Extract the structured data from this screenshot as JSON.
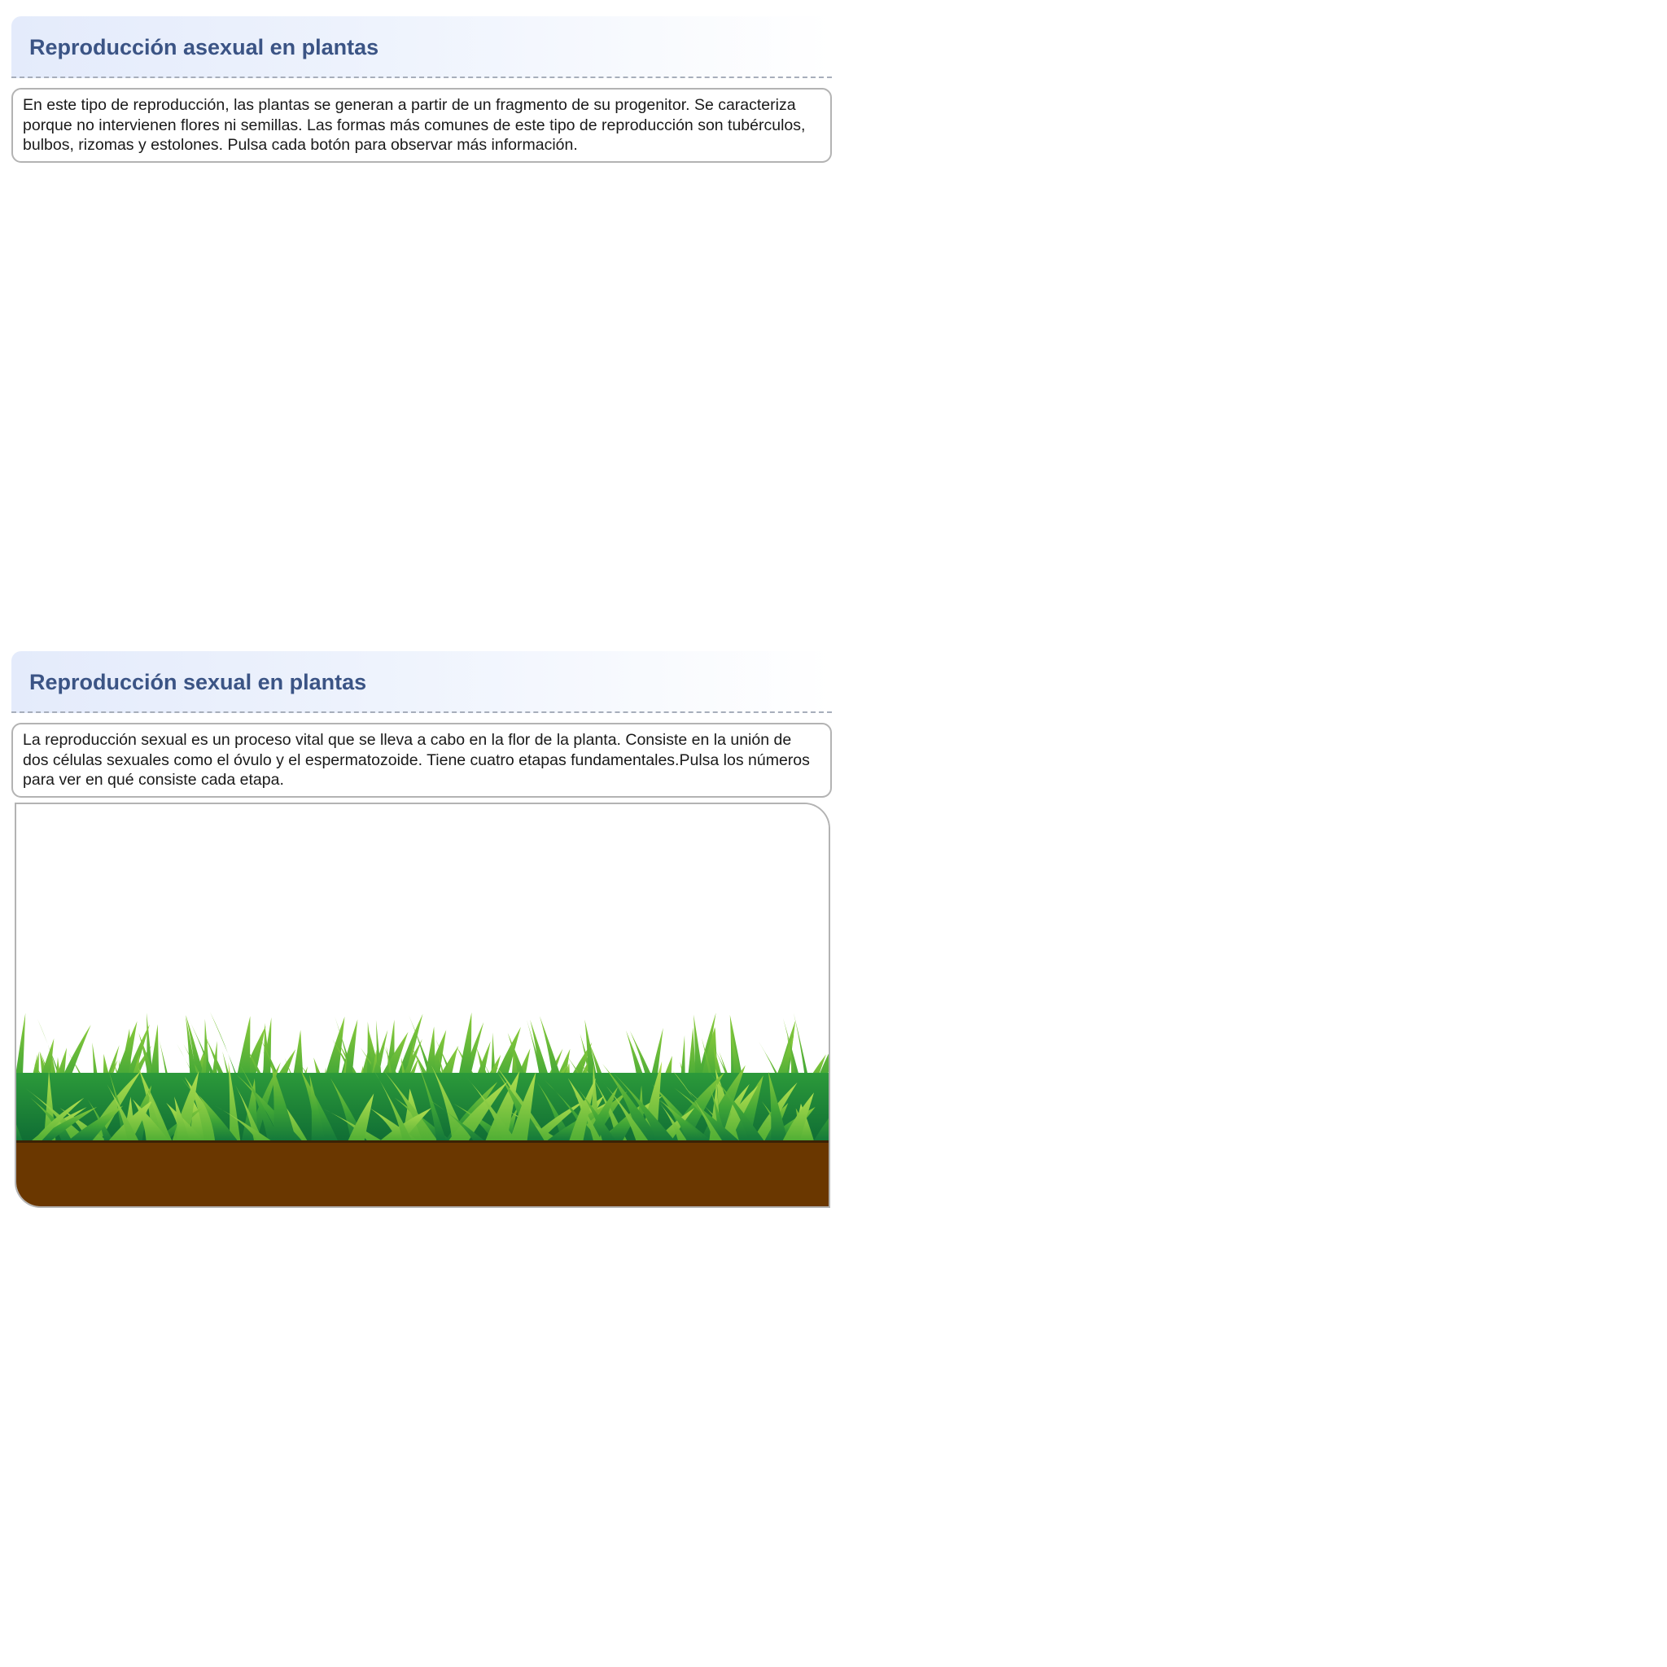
{
  "asexual": {
    "title": "Reproducción asexual en plantas",
    "description": "En este tipo de reproducción, las plantas se generan a partir de un fragmento de su progenitor. Se caracteriza porque no intervienen flores ni semillas. Las formas más comunes de este tipo de reproducción son tubérculos, bulbos, rizomas y estolones. Pulsa cada botón para observar más información."
  },
  "sexual": {
    "title": "Reproducción sexual en plantas",
    "description": "La reproducción sexual es un proceso vital que se lleva a cabo en la flor de la planta. Consiste en la unión de dos células sexuales como el óvulo y el espermatozoide. Tiene cuatro etapas fundamentales.Pulsa los números para ver en qué consiste cada etapa."
  },
  "colors": {
    "title_text": "#3b5485",
    "header_gradient_start": "#e4ebfb",
    "soil": "#6a3700",
    "grass_dark": "#1f8a3a",
    "grass_light": "#8ccc3c"
  }
}
